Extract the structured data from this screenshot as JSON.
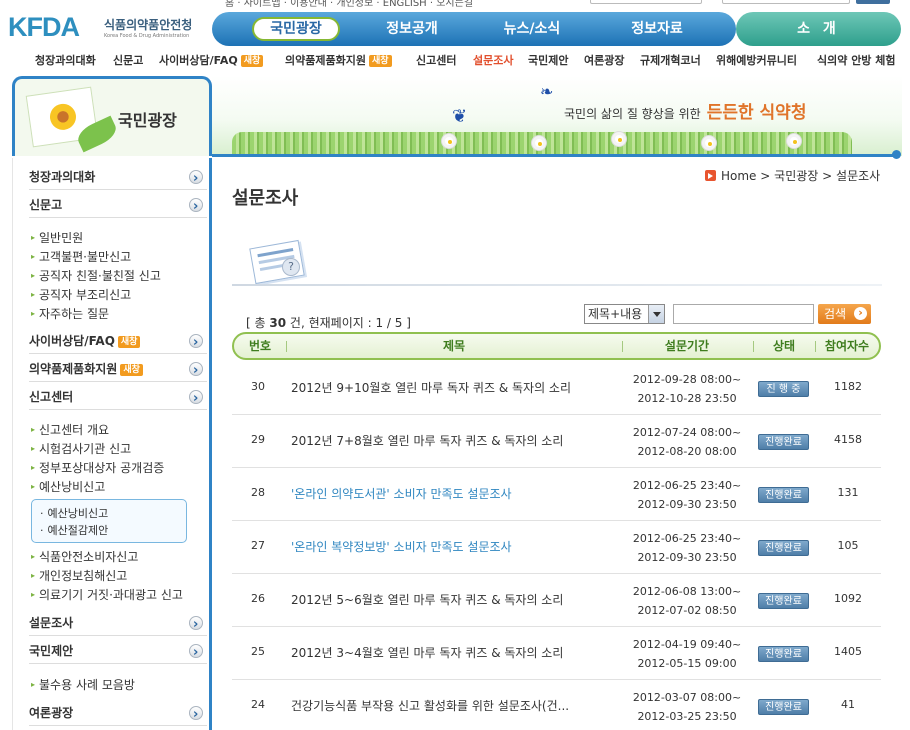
{
  "logo": {
    "mark_text": "KFDA",
    "name_ko": "식품의약품안전청",
    "name_en": "Korea Food & Drug Administration"
  },
  "top_util": "홈 · 사이트맵 · 이용안내 · 개인정보 · ENGLISH · 오시는길",
  "gnb": {
    "items": [
      "국민광장",
      "정보공개",
      "뉴스/소식",
      "정보자료"
    ],
    "about": "소 개"
  },
  "subnav": [
    {
      "label": "청장과의대화",
      "badge": ""
    },
    {
      "label": "신문고",
      "badge": ""
    },
    {
      "label": "사이버상담/FAQ",
      "badge": "새창"
    },
    {
      "label": "의약품제품화지원",
      "badge": "새창"
    },
    {
      "label": "신고센터",
      "badge": ""
    },
    {
      "label": "설문조사",
      "badge": ""
    },
    {
      "label": "국민제안",
      "badge": ""
    },
    {
      "label": "여론광장",
      "badge": ""
    },
    {
      "label": "규제개혁코너",
      "badge": ""
    },
    {
      "label": "위해예방커뮤니티",
      "badge": ""
    },
    {
      "label": "식의약 안방 체험",
      "badge": ""
    }
  ],
  "banner": {
    "section_title": "국민광장",
    "slogan_prefix": "국민의 삶의 질 향상을 위한",
    "slogan_bold": "든든한 식약청"
  },
  "sidebar": {
    "menu": {
      "m1": "청장과의대화",
      "m2": "신문고",
      "m3": "사이버상담/FAQ",
      "m3_badge": "새창",
      "m4": "의약품제품화지원",
      "m4_badge": "새창",
      "m5": "신고센터",
      "m6": "설문조사",
      "m7": "국민제안",
      "m8": "여론광장"
    },
    "sinmungo_items": [
      "일반민원",
      "고객불편·불만신고",
      "공직자 친절·불친절 신고",
      "공직자 부조리신고",
      "자주하는 질문"
    ],
    "report_items": [
      "신고센터 개요",
      "시험검사기관 신고",
      "정부포상대상자 공개검증",
      "예산낭비신고"
    ],
    "report_box": [
      "예산낭비신고",
      "예산절감제안"
    ],
    "report_items2": [
      "식품안전소비자신고",
      "개인정보침해신고",
      "의료기기 거짓·과대광고 신고"
    ],
    "proposal_items": [
      "불수용 사례 모음방"
    ]
  },
  "breadcrumb": {
    "home": "Home",
    "sep": ">",
    "level1": "국민광장",
    "level2": "설문조사"
  },
  "page_title": "설문조사",
  "list_info": {
    "prefix": "[ 총",
    "total": "30",
    "mid": "건, 현재페이지 :",
    "page": "1 / 5",
    "suffix": "]"
  },
  "search": {
    "select_value": "제목+내용",
    "input_value": "",
    "button_label": "검색"
  },
  "table": {
    "headers": [
      "번호",
      "제목",
      "설문기간",
      "상태",
      "참여자수"
    ],
    "rows": [
      {
        "no": "30",
        "title": "2012년 9+10월호 열린 마루 독자 퀴즈 & 독자의 소리",
        "start": "2012-09-28 08:00~",
        "end": "2012-10-28 23:50",
        "status": "진 행 중",
        "count": "1182",
        "link": false
      },
      {
        "no": "29",
        "title": "2012년 7+8월호 열린 마루 독자 퀴즈 & 독자의 소리",
        "start": "2012-07-24 08:00~",
        "end": "2012-08-20 08:00",
        "status": "진행완료",
        "count": "4158",
        "link": false
      },
      {
        "no": "28",
        "title": "'온라인 의약도서관' 소비자 만족도 설문조사",
        "start": "2012-06-25 23:40~",
        "end": "2012-09-30 23:50",
        "status": "진행완료",
        "count": "131",
        "link": true
      },
      {
        "no": "27",
        "title": "'온라인 복약정보방' 소비자 만족도 설문조사",
        "start": "2012-06-25 23:40~",
        "end": "2012-09-30 23:50",
        "status": "진행완료",
        "count": "105",
        "link": true
      },
      {
        "no": "26",
        "title": "2012년 5~6월호 열린 마루 독자 퀴즈 & 독자의 소리",
        "start": "2012-06-08 13:00~",
        "end": "2012-07-02 08:50",
        "status": "진행완료",
        "count": "1092",
        "link": false
      },
      {
        "no": "25",
        "title": "2012년 3~4월호 열린 마루 독자 퀴즈 & 독자의 소리",
        "start": "2012-04-19 09:40~",
        "end": "2012-05-15 09:00",
        "status": "진행완료",
        "count": "1405",
        "link": false
      },
      {
        "no": "24",
        "title": "건강기능식품 부작용 신고 활성화를 위한 설문조사(건...",
        "start": "2012-03-07 08:00~",
        "end": "2012-03-25 23:50",
        "status": "진행완료",
        "count": "41",
        "link": false
      }
    ]
  },
  "colors": {
    "brand_blue": "#2f83c6",
    "brand_green": "#86b833",
    "accent_orange": "#e27b1a",
    "current_red": "#e2502e"
  }
}
